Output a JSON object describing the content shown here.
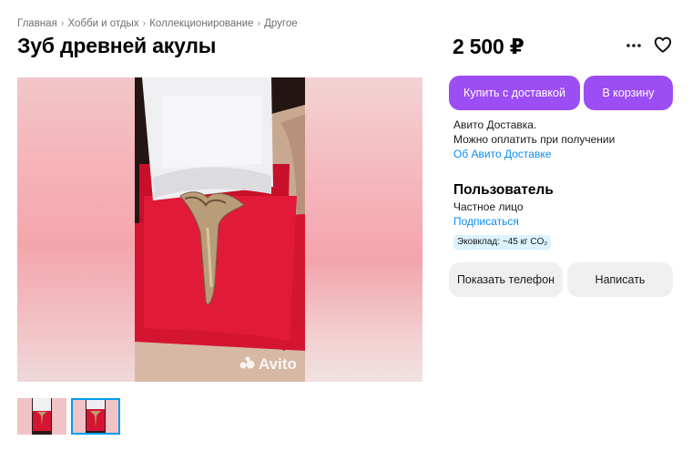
{
  "breadcrumbs": [
    "Главная",
    "Хобби и отдых",
    "Коллекционирование",
    "Другое"
  ],
  "listing": {
    "title": "Зуб древней акулы",
    "price": "2 500 ₽"
  },
  "gallery": {
    "watermark": "Avito",
    "thumbnail_count": 2,
    "active_thumbnail": 2
  },
  "actions": {
    "buy_label": "Купить с доставкой",
    "cart_label": "В корзину",
    "phone_label": "Показать телефон",
    "write_label": "Написать"
  },
  "delivery": {
    "line1": "Авито Доставка.",
    "line2": "Можно оплатить при получении",
    "link": "Об Авито Доставке"
  },
  "seller": {
    "name": "Пользователь",
    "type": "Частное лицо",
    "subscribe": "Подписаться",
    "eco_badge": "Эковклад: ~45 кг CO₂"
  },
  "icons": [
    "more-icon",
    "heart-icon",
    "avito-logo-icon"
  ],
  "colors": {
    "primary_button": "#9d4df4",
    "secondary_button": "#efefef",
    "link": "#0a8ef0",
    "eco_badge_bg": "#dbf3ff",
    "thumbnail_active_border": "#009cf0"
  }
}
